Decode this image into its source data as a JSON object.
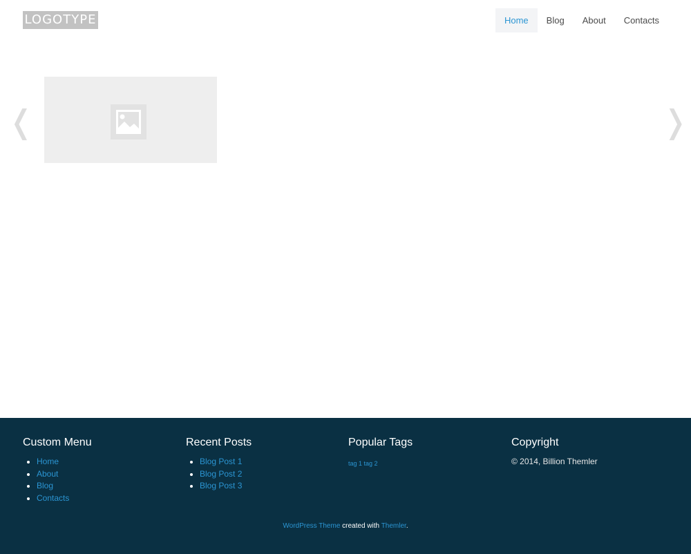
{
  "colors": {
    "accent": "#2b95d3",
    "footer_bg": "#0a3043",
    "logo_bg": "#c2c2c2",
    "placeholder_bg": "#eeeeee"
  },
  "header": {
    "logo_text": "LOGOTYPE",
    "nav": [
      {
        "label": "Home",
        "active": true
      },
      {
        "label": "Blog",
        "active": false
      },
      {
        "label": "About",
        "active": false
      },
      {
        "label": "Contacts",
        "active": false
      }
    ]
  },
  "slider": {
    "prev_arrow": "❬",
    "next_arrow": "❭",
    "image_icon": "image-placeholder-icon"
  },
  "footer": {
    "custom_menu": {
      "title": "Custom Menu",
      "items": [
        "Home",
        "About",
        "Blog",
        "Contacts"
      ]
    },
    "recent_posts": {
      "title": "Recent Posts",
      "items": [
        "Blog Post 1",
        "Blog Post 2",
        "Blog Post 3"
      ]
    },
    "popular_tags": {
      "title": "Popular Tags",
      "tags": [
        "tag 1",
        "tag 2"
      ]
    },
    "copyright": {
      "title": "Copyright",
      "text": "© 2014, Billion Themler"
    },
    "credits": {
      "link1": "WordPress Theme",
      "middle": " created with ",
      "link2": "Themler",
      "end": "."
    }
  }
}
